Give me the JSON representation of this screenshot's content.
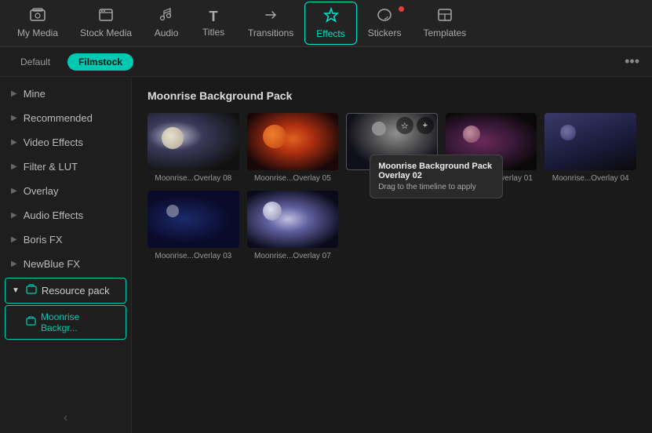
{
  "nav": {
    "items": [
      {
        "id": "my-media",
        "label": "My Media",
        "icon": "🎞"
      },
      {
        "id": "stock-media",
        "label": "Stock Media",
        "icon": "📦"
      },
      {
        "id": "audio",
        "label": "Audio",
        "icon": "🎵"
      },
      {
        "id": "titles",
        "label": "Titles",
        "icon": "T"
      },
      {
        "id": "transitions",
        "label": "Transitions",
        "icon": "➤"
      },
      {
        "id": "effects",
        "label": "Effects",
        "icon": "✦",
        "active": true
      },
      {
        "id": "stickers",
        "label": "Stickers",
        "icon": "🌟"
      },
      {
        "id": "templates",
        "label": "Templates",
        "icon": "▦"
      }
    ]
  },
  "filter": {
    "buttons": [
      {
        "id": "default",
        "label": "Default",
        "active": false
      },
      {
        "id": "filmstock",
        "label": "Filmstock",
        "active": true
      }
    ],
    "more_label": "•••"
  },
  "sidebar": {
    "items": [
      {
        "id": "mine",
        "label": "Mine"
      },
      {
        "id": "recommended",
        "label": "Recommended"
      },
      {
        "id": "video-effects",
        "label": "Video Effects"
      },
      {
        "id": "filter-lut",
        "label": "Filter & LUT"
      },
      {
        "id": "overlay",
        "label": "Overlay"
      },
      {
        "id": "audio-effects",
        "label": "Audio Effects"
      },
      {
        "id": "boris-fx",
        "label": "Boris FX"
      },
      {
        "id": "newblue-fx",
        "label": "NewBlue FX"
      }
    ],
    "resource_pack_label": "Resource pack",
    "subitem_label": "Moonrise Backgr...",
    "collapse_hint": "‹"
  },
  "content": {
    "section_title": "Moonrise Background Pack",
    "effects": [
      {
        "id": "overlay-08",
        "label": "Moonrise...Overlay 08",
        "thumb": "thumb-08"
      },
      {
        "id": "overlay-05",
        "label": "Moonrise...Overlay 05",
        "thumb": "thumb-05"
      },
      {
        "id": "overlay-02",
        "label": "Moonrise...Overlay 02",
        "thumb": "thumb-02",
        "hovered": true
      },
      {
        "id": "overlay-01",
        "label": "Moonrise...k Overlay 01",
        "thumb": "thumb-01"
      },
      {
        "id": "overlay-04",
        "label": "Moonrise...Overlay 04",
        "thumb": "thumb-04"
      },
      {
        "id": "overlay-03",
        "label": "Moonrise...Overlay 03",
        "thumb": "thumb-03"
      },
      {
        "id": "overlay-07",
        "label": "Moonrise...Overlay 07",
        "thumb": "thumb-07"
      }
    ],
    "tooltip": {
      "title": "Moonrise Background Pack Overlay 02",
      "sub": "Drag to the timeline to apply"
    }
  }
}
